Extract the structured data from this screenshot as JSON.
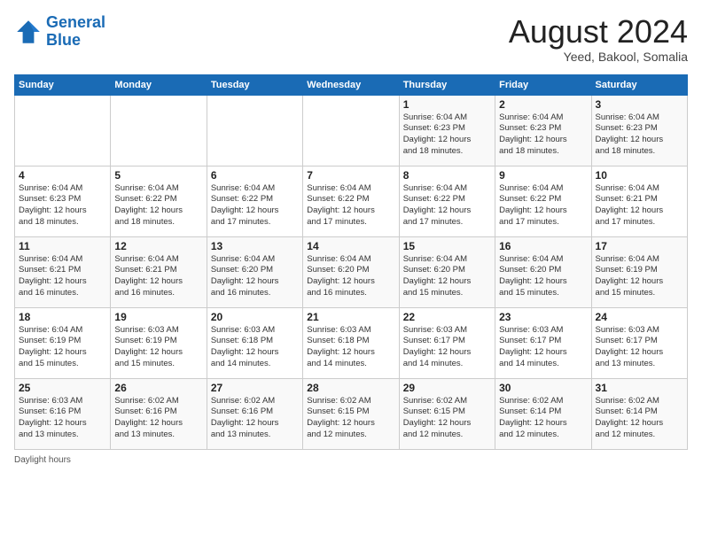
{
  "header": {
    "logo_line1": "General",
    "logo_line2": "Blue",
    "month_year": "August 2024",
    "location": "Yeed, Bakool, Somalia"
  },
  "days_of_week": [
    "Sunday",
    "Monday",
    "Tuesday",
    "Wednesday",
    "Thursday",
    "Friday",
    "Saturday"
  ],
  "weeks": [
    [
      {
        "day": "",
        "info": ""
      },
      {
        "day": "",
        "info": ""
      },
      {
        "day": "",
        "info": ""
      },
      {
        "day": "",
        "info": ""
      },
      {
        "day": "1",
        "info": "Sunrise: 6:04 AM\nSunset: 6:23 PM\nDaylight: 12 hours\nand 18 minutes."
      },
      {
        "day": "2",
        "info": "Sunrise: 6:04 AM\nSunset: 6:23 PM\nDaylight: 12 hours\nand 18 minutes."
      },
      {
        "day": "3",
        "info": "Sunrise: 6:04 AM\nSunset: 6:23 PM\nDaylight: 12 hours\nand 18 minutes."
      }
    ],
    [
      {
        "day": "4",
        "info": "Sunrise: 6:04 AM\nSunset: 6:23 PM\nDaylight: 12 hours\nand 18 minutes."
      },
      {
        "day": "5",
        "info": "Sunrise: 6:04 AM\nSunset: 6:22 PM\nDaylight: 12 hours\nand 18 minutes."
      },
      {
        "day": "6",
        "info": "Sunrise: 6:04 AM\nSunset: 6:22 PM\nDaylight: 12 hours\nand 17 minutes."
      },
      {
        "day": "7",
        "info": "Sunrise: 6:04 AM\nSunset: 6:22 PM\nDaylight: 12 hours\nand 17 minutes."
      },
      {
        "day": "8",
        "info": "Sunrise: 6:04 AM\nSunset: 6:22 PM\nDaylight: 12 hours\nand 17 minutes."
      },
      {
        "day": "9",
        "info": "Sunrise: 6:04 AM\nSunset: 6:22 PM\nDaylight: 12 hours\nand 17 minutes."
      },
      {
        "day": "10",
        "info": "Sunrise: 6:04 AM\nSunset: 6:21 PM\nDaylight: 12 hours\nand 17 minutes."
      }
    ],
    [
      {
        "day": "11",
        "info": "Sunrise: 6:04 AM\nSunset: 6:21 PM\nDaylight: 12 hours\nand 16 minutes."
      },
      {
        "day": "12",
        "info": "Sunrise: 6:04 AM\nSunset: 6:21 PM\nDaylight: 12 hours\nand 16 minutes."
      },
      {
        "day": "13",
        "info": "Sunrise: 6:04 AM\nSunset: 6:20 PM\nDaylight: 12 hours\nand 16 minutes."
      },
      {
        "day": "14",
        "info": "Sunrise: 6:04 AM\nSunset: 6:20 PM\nDaylight: 12 hours\nand 16 minutes."
      },
      {
        "day": "15",
        "info": "Sunrise: 6:04 AM\nSunset: 6:20 PM\nDaylight: 12 hours\nand 15 minutes."
      },
      {
        "day": "16",
        "info": "Sunrise: 6:04 AM\nSunset: 6:20 PM\nDaylight: 12 hours\nand 15 minutes."
      },
      {
        "day": "17",
        "info": "Sunrise: 6:04 AM\nSunset: 6:19 PM\nDaylight: 12 hours\nand 15 minutes."
      }
    ],
    [
      {
        "day": "18",
        "info": "Sunrise: 6:04 AM\nSunset: 6:19 PM\nDaylight: 12 hours\nand 15 minutes."
      },
      {
        "day": "19",
        "info": "Sunrise: 6:03 AM\nSunset: 6:19 PM\nDaylight: 12 hours\nand 15 minutes."
      },
      {
        "day": "20",
        "info": "Sunrise: 6:03 AM\nSunset: 6:18 PM\nDaylight: 12 hours\nand 14 minutes."
      },
      {
        "day": "21",
        "info": "Sunrise: 6:03 AM\nSunset: 6:18 PM\nDaylight: 12 hours\nand 14 minutes."
      },
      {
        "day": "22",
        "info": "Sunrise: 6:03 AM\nSunset: 6:17 PM\nDaylight: 12 hours\nand 14 minutes."
      },
      {
        "day": "23",
        "info": "Sunrise: 6:03 AM\nSunset: 6:17 PM\nDaylight: 12 hours\nand 14 minutes."
      },
      {
        "day": "24",
        "info": "Sunrise: 6:03 AM\nSunset: 6:17 PM\nDaylight: 12 hours\nand 13 minutes."
      }
    ],
    [
      {
        "day": "25",
        "info": "Sunrise: 6:03 AM\nSunset: 6:16 PM\nDaylight: 12 hours\nand 13 minutes."
      },
      {
        "day": "26",
        "info": "Sunrise: 6:02 AM\nSunset: 6:16 PM\nDaylight: 12 hours\nand 13 minutes."
      },
      {
        "day": "27",
        "info": "Sunrise: 6:02 AM\nSunset: 6:16 PM\nDaylight: 12 hours\nand 13 minutes."
      },
      {
        "day": "28",
        "info": "Sunrise: 6:02 AM\nSunset: 6:15 PM\nDaylight: 12 hours\nand 12 minutes."
      },
      {
        "day": "29",
        "info": "Sunrise: 6:02 AM\nSunset: 6:15 PM\nDaylight: 12 hours\nand 12 minutes."
      },
      {
        "day": "30",
        "info": "Sunrise: 6:02 AM\nSunset: 6:14 PM\nDaylight: 12 hours\nand 12 minutes."
      },
      {
        "day": "31",
        "info": "Sunrise: 6:02 AM\nSunset: 6:14 PM\nDaylight: 12 hours\nand 12 minutes."
      }
    ]
  ],
  "footer": {
    "note": "Daylight hours"
  }
}
